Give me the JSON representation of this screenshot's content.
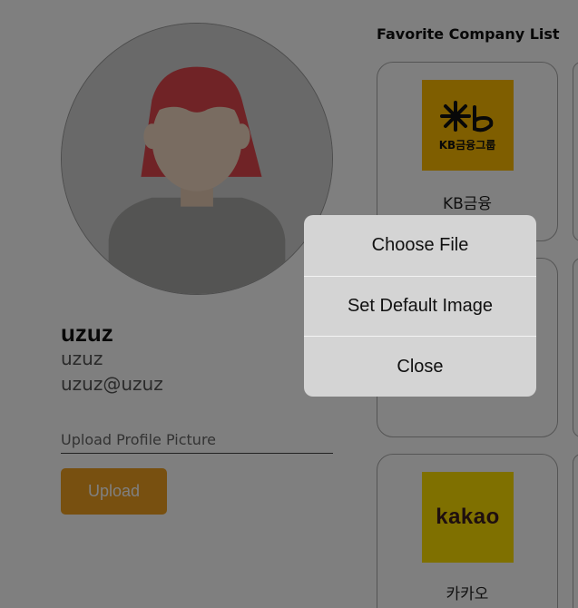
{
  "profile": {
    "display_name": "uzuz",
    "username": "uzuz",
    "email": "uzuz@uzuz",
    "upload_placeholder": "Upload Profile Picture",
    "upload_button_label": "Upload"
  },
  "favorites": {
    "title": "Favorite Company List",
    "companies": [
      {
        "name": "KB금융",
        "logo": "kb-financial-logo",
        "logo_text": "KB금융그룹"
      },
      {
        "name": "",
        "logo": ""
      },
      {
        "name": "카카오",
        "logo": "kakao-logo",
        "logo_text": "kakao"
      }
    ]
  },
  "modal": {
    "options": [
      "Choose File",
      "Set Default Image",
      "Close"
    ]
  },
  "colors": {
    "accent": "#f0a020",
    "kb_yellow": "#ffbc00",
    "kakao_yellow": "#ffe100",
    "overlay": "rgba(0,0,0,0.5)",
    "modal_bg": "#d4d4d4"
  }
}
